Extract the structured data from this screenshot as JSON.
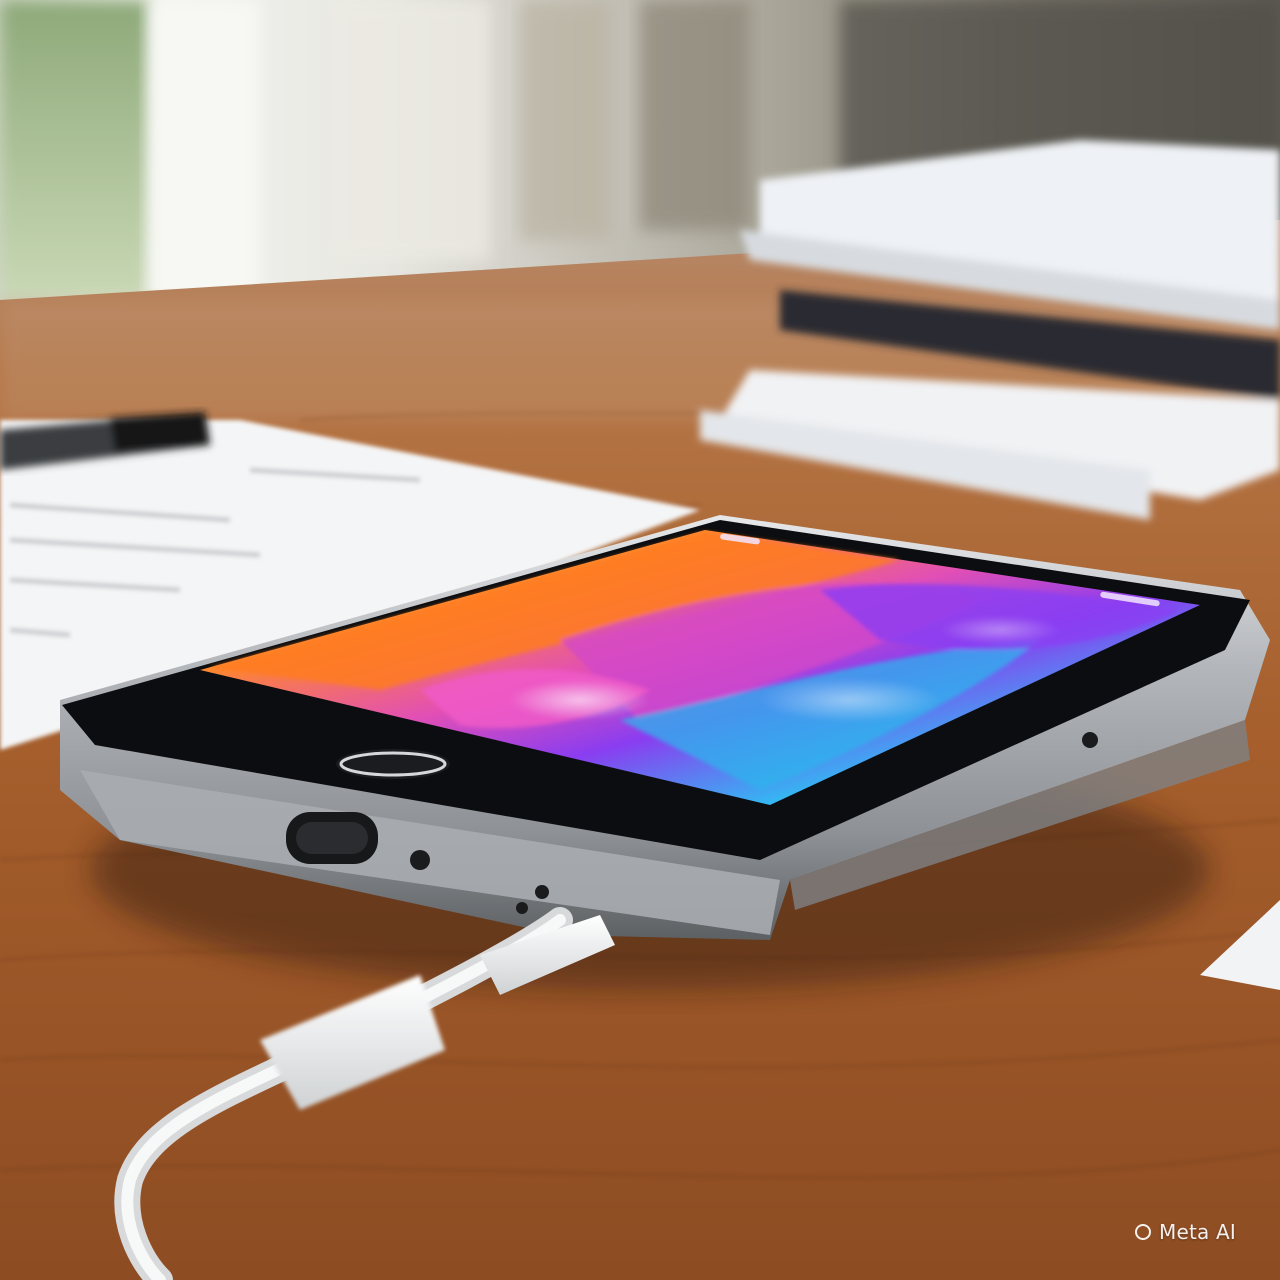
{
  "watermark": {
    "text": "Meta AI",
    "icon": "meta-ai-ring-icon"
  },
  "colors": {
    "desk_wood": "#a7622d",
    "window_light": "#eef0ea",
    "phone_frame": "#b9bcc0",
    "phone_bezel": "#0c0d10"
  }
}
